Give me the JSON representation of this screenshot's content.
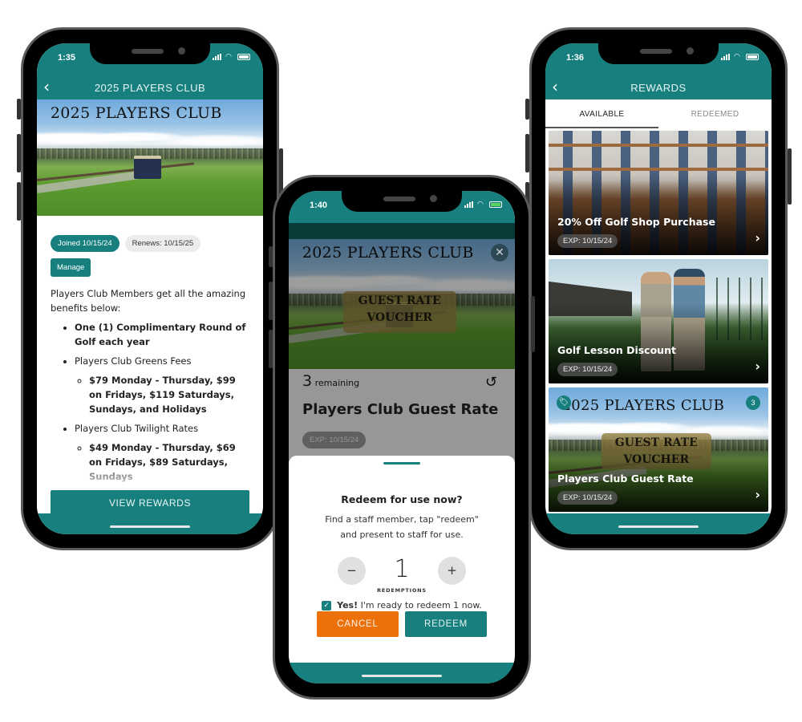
{
  "colors": {
    "brand_teal": "#17807e",
    "cancel_orange": "#ec7108",
    "chip_grey": "#ececec"
  },
  "phone1": {
    "status": {
      "time": "1:35"
    },
    "header": {
      "title": "2025 PLAYERS CLUB",
      "back_icon": "chevron-left-icon"
    },
    "hero": {
      "title": "2025 PLAYERS CLUB"
    },
    "chips": {
      "joined": "Joined 10/15/24",
      "renews": "Renews: 10/15/25"
    },
    "manage_label": "Manage",
    "intro": "Players Club Members get all the amazing benefits below:",
    "benefits": [
      {
        "text": "One (1) Complimentary Round of Golf each year",
        "bold": true
      },
      {
        "text": "Players Club Greens Fees",
        "sub": "$79 Monday - Thursday, $99 on Fridays, $119 Saturdays, Sundays, and Holidays"
      },
      {
        "text": "Players Club Twilight Rates",
        "sub": "$49 Monday - Thursday, $69 on Fridays, $89 Saturdays, Sundays"
      }
    ],
    "view_rewards_label": "VIEW REWARDS"
  },
  "phone2": {
    "status": {
      "time": "1:40"
    },
    "hero": {
      "title": "2025 PLAYERS CLUB",
      "voucher_line1": "GUEST RATE",
      "voucher_line2": "VOUCHER"
    },
    "close_icon": "close-icon",
    "remaining": {
      "count": "3",
      "label": "remaining"
    },
    "history_icon": "history-icon",
    "title": "Players Club Guest Rate",
    "exp": "EXP: 10/15/24",
    "sheet": {
      "title": "Redeem for use now?",
      "description": "Find a staff member, tap \"redeem\" and present to staff for use.",
      "minus": "−",
      "plus": "+",
      "quantity": "1",
      "quantity_label": "REDEMPTIONS",
      "confirm_bold": "Yes!",
      "confirm_text": "I'm ready to redeem 1 now.",
      "confirm_checked": true,
      "cancel_label": "CANCEL",
      "redeem_label": "REDEEM"
    }
  },
  "phone3": {
    "status": {
      "time": "1:36"
    },
    "header": {
      "title": "REWARDS"
    },
    "tabs": [
      {
        "label": "AVAILABLE",
        "active": true
      },
      {
        "label": "REDEEMED",
        "active": false
      }
    ],
    "rewards": [
      {
        "title": "20% Off Golf Shop Purchase",
        "exp": "EXP: 10/15/24",
        "image": "golf-shop"
      },
      {
        "title": "Golf Lesson Discount",
        "exp": "EXP: 10/15/24",
        "image": "golf-lesson"
      },
      {
        "title": "Players Club Guest Rate",
        "exp": "EXP: 10/15/24",
        "image": "players-club-voucher",
        "badge_count": "3",
        "image_title": "2025 PLAYERS CLUB",
        "voucher_line1": "GUEST RATE",
        "voucher_line2": "VOUCHER"
      }
    ]
  }
}
